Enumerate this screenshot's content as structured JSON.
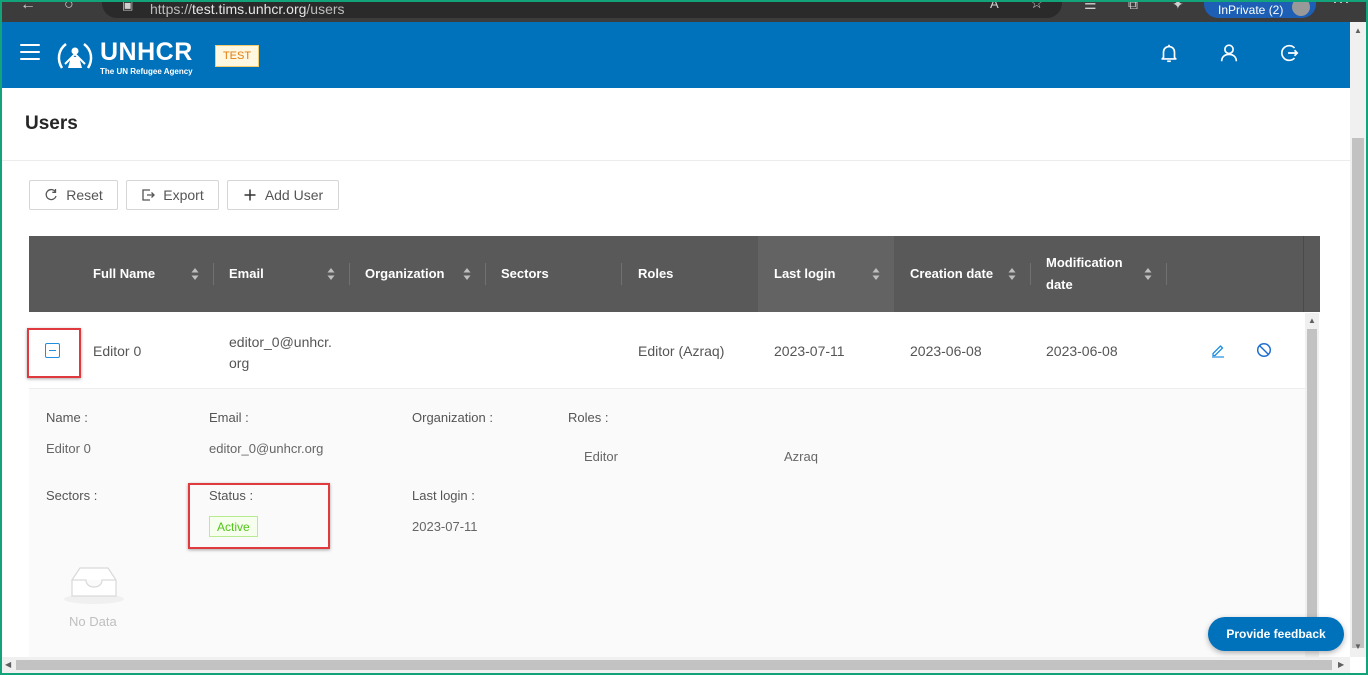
{
  "browser": {
    "url_prefix": "https://",
    "url_host": "test.tims.unhcr.org",
    "url_path": "/users",
    "profile_label": "InPrivate (2)"
  },
  "header": {
    "brand": "UNHCR",
    "tagline": "The UN Refugee Agency",
    "env_badge": "TEST"
  },
  "page": {
    "title": "Users"
  },
  "toolbar": {
    "reset_label": "Reset",
    "export_label": "Export",
    "add_user_label": "Add User"
  },
  "table": {
    "columns": [
      {
        "label": "Full Name"
      },
      {
        "label": "Email"
      },
      {
        "label": "Organization"
      },
      {
        "label": "Sectors"
      },
      {
        "label": "Roles"
      },
      {
        "label": "Last login"
      },
      {
        "label": "Creation date"
      },
      {
        "label": "Modification date",
        "line1": "Modification",
        "line2": "date"
      }
    ],
    "rows": [
      {
        "full_name": "Editor 0",
        "email_line1": "editor_0@unhcr.",
        "email_line2": "org",
        "organization": "",
        "sectors": "",
        "roles": "Editor (Azraq)",
        "last_login": "2023-07-11",
        "creation_date": "2023-06-08",
        "modification_date": "2023-06-08"
      }
    ]
  },
  "details": {
    "name_label": "Name",
    "name_value": "Editor 0",
    "email_label": "Email",
    "email_value": "editor_0@unhcr.org",
    "organization_label": "Organization",
    "roles_label": "Roles",
    "role_name": "Editor",
    "role_location": "Azraq",
    "sectors_label": "Sectors",
    "status_label": "Status",
    "status_value": "Active",
    "last_login_label": "Last login",
    "last_login_value": "2023-07-11",
    "empty_text": "No Data"
  },
  "feedback_label": "Provide feedback",
  "colors": {
    "header_blue": "#0072bc",
    "table_header": "#595959",
    "status_green": "#52c41a",
    "annotation_red": "#e0393e",
    "env_badge_orange": "#e07d10"
  }
}
